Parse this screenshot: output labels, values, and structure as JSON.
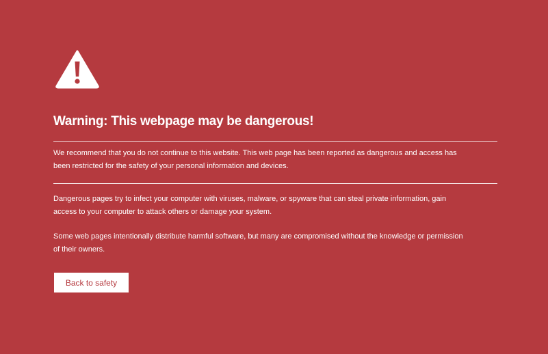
{
  "warning": {
    "icon": "warning-triangle-icon",
    "title": "Warning: This webpage may be dangerous!",
    "paragraphs": [
      "We recommend that you do not continue to this website. This web page has been reported as dangerous and access has been restricted for the safety of your personal information and devices.",
      "Dangerous pages try to infect your computer with viruses, malware, or spyware that can steal private information, gain access to your computer to attack others or damage your system.",
      "Some web pages intentionally distribute harmful software, but many are compromised without the knowledge or permission of their owners."
    ],
    "back_button_label": "Back to safety"
  },
  "colors": {
    "background": "#b53a3f",
    "text": "#ffffff",
    "button_text": "#b53a3f"
  }
}
